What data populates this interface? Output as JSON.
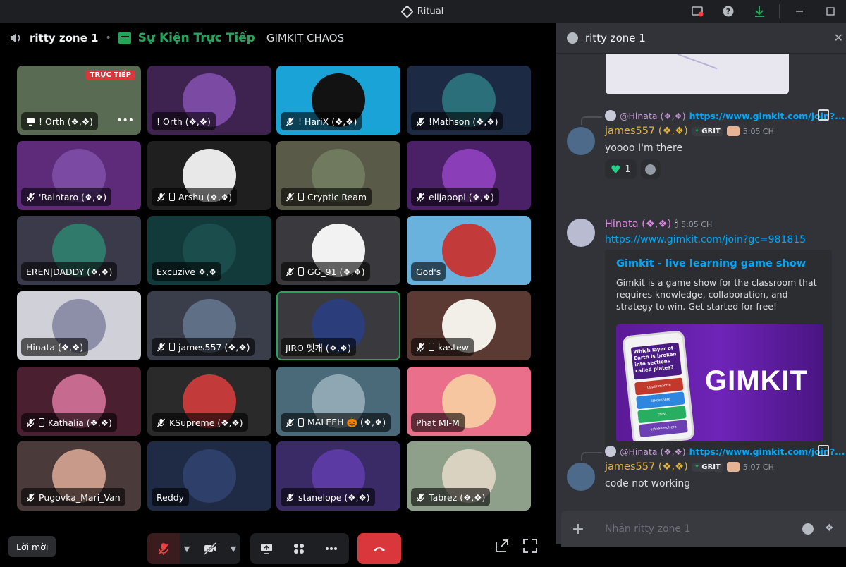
{
  "window": {
    "title": "Ritual"
  },
  "voice": {
    "channel": "ritty zone 1",
    "event": "Sự Kiện Trực Tiếp",
    "game": "GIMKIT CHAOS",
    "live_badge": "TRỰC TIẾP",
    "tiles": [
      {
        "name": "! Orth (❖,❖)",
        "bg": "#5a6b53",
        "av": "",
        "icon": "screen"
      },
      {
        "name": "! Orth (❖,❖)",
        "bg": "#3e2350",
        "av": "#7b4aa3",
        "icon": "none"
      },
      {
        "name": "! HariX (❖,❖)",
        "bg": "#1aa3d6",
        "av": "#121212",
        "icon": "mute"
      },
      {
        "name": "!Mathson (❖,❖)",
        "bg": "#1c2a44",
        "av": "#2a6f7a",
        "icon": "mute"
      },
      {
        "name": "'Raintaro (❖,❖)",
        "bg": "#5e2b7a",
        "av": "#7b4aa3",
        "icon": "mute"
      },
      {
        "name": "Arshu (❖,❖)",
        "bg": "#1f1f1f",
        "av": "#e8e8e8",
        "icon": "mute-phone"
      },
      {
        "name": "Cryptic Ream",
        "bg": "#5a5a48",
        "av": "#6f7a5f",
        "icon": "mute-phone"
      },
      {
        "name": "elijapopi (❖,❖)",
        "bg": "#4a2166",
        "av": "#8a3fb8",
        "icon": "mute"
      },
      {
        "name": "EREN|DADDY (❖,❖)",
        "bg": "#3b3a4a",
        "av": "#2f7a6a",
        "icon": "none"
      },
      {
        "name": "Excuzive ❖,❖",
        "bg": "#123a3a",
        "av": "#1b4d4d",
        "icon": "none"
      },
      {
        "name": "GG_91 (❖,❖)",
        "bg": "#3a3a3e",
        "av": "#f2f2f2",
        "icon": "mute-phone"
      },
      {
        "name": "God's",
        "bg": "#6ab2de",
        "av": "#c23a3a",
        "icon": "none"
      },
      {
        "name": "Hinata (❖,❖)",
        "bg": "#cfd0d8",
        "av": "#8d8fa8",
        "icon": "none"
      },
      {
        "name": "james557 (❖,❖)",
        "bg": "#3a3d4a",
        "av": "#5f6f86",
        "icon": "mute-phone"
      },
      {
        "name": "JIRO 멧개 (❖,❖)",
        "bg": "#3a3a3e",
        "av": "#2b3d7a",
        "icon": "none",
        "speaking": true
      },
      {
        "name": "kastew",
        "bg": "#5a3a32",
        "av": "#f2efe9",
        "icon": "mute-phone"
      },
      {
        "name": "Kathalia (❖,❖)",
        "bg": "#4a2030",
        "av": "#c76a8f",
        "icon": "mute-phone"
      },
      {
        "name": "KSupreme (❖,❖)",
        "bg": "#2a2a2a",
        "av": "#c23a3a",
        "icon": "mute"
      },
      {
        "name": "MALEEH 🎃 (❖,❖)",
        "bg": "#4a6a7a",
        "av": "#8fa7b3",
        "icon": "mute-phone"
      },
      {
        "name": "Phat MI-M",
        "bg": "#ea6f8a",
        "av": "#f5c6a0",
        "icon": "none"
      },
      {
        "name": "Pugovka_Mari_Van",
        "bg": "#4a3a3a",
        "av": "#c79a8a",
        "icon": "mute-off"
      },
      {
        "name": "Reddy",
        "bg": "#1f2a44",
        "av": "#2e3f6a",
        "icon": "none"
      },
      {
        "name": "stanelope (❖,❖)",
        "bg": "#3a2b66",
        "av": "#5b3aa3",
        "icon": "mute"
      },
      {
        "name": "Tabrez (❖,❖)",
        "bg": "#8fa08a",
        "av": "#d9d2c0",
        "icon": "mute"
      }
    ]
  },
  "controls": {
    "invite": "Lời mời"
  },
  "chat": {
    "channel": "ritty zone 1",
    "messages": [
      {
        "reply_name": "@Hinata (❖,❖)",
        "reply_link": "https://www.gimkit.com/join?...",
        "user": "james557 (❖,❖)",
        "tag": "GRIT",
        "time": "5:05 CH",
        "text": "yoooo I'm there",
        "reaction_count": "1"
      },
      {
        "user": "Hinata (❖,❖)",
        "time": "5:05 CH",
        "link": "https://www.gimkit.com/join?gc=981815",
        "embed_title": "Gimkit - live learning game show",
        "embed_desc": "Gimkit is a game show for the classroom that requires knowledge, collaboration, and strategy to win. Get started for free!",
        "embed_brand": "GIMKIT",
        "embed_question": "Which layer of Earth is broken into sections called plates?",
        "embed_options": [
          "upper mantle",
          "lithosphere",
          "crust",
          "asthenosphere"
        ]
      },
      {
        "reply_name": "@Hinata (❖,❖)",
        "reply_link": "https://www.gimkit.com/join?...",
        "user": "james557 (❖,❖)",
        "tag": "GRIT",
        "time": "5:07 CH",
        "text": "code not working"
      }
    ],
    "composer_placeholder": "Nhắn ritty zone 1"
  }
}
